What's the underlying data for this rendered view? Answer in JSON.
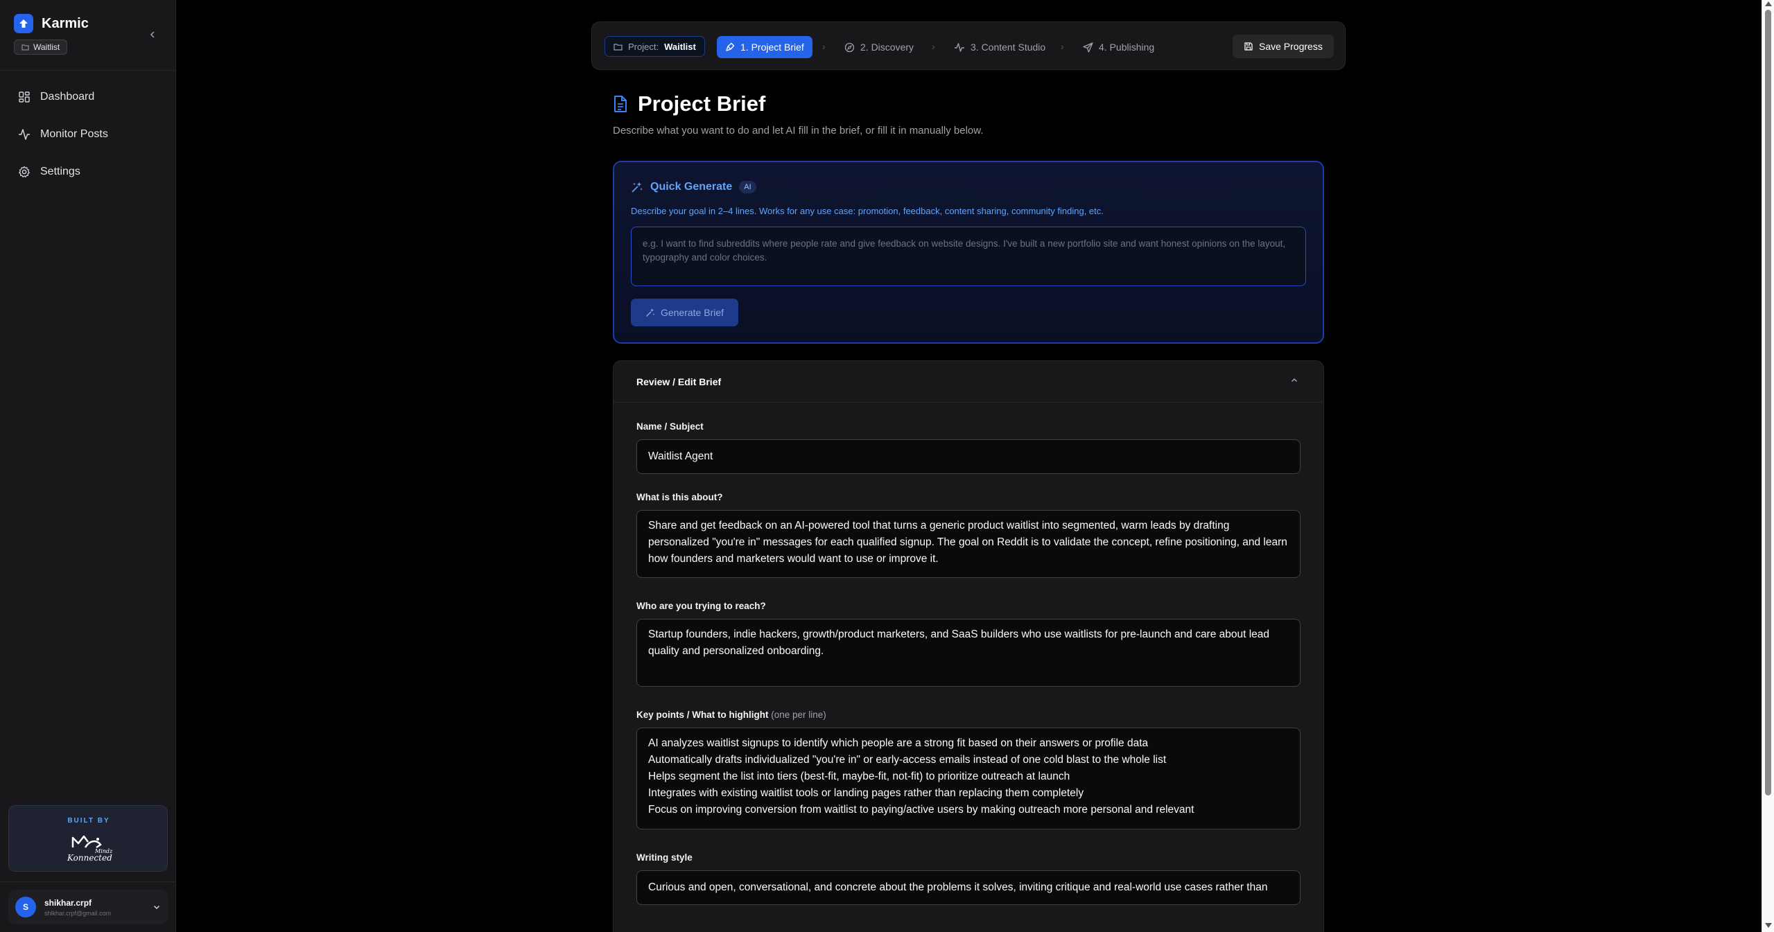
{
  "sidebar": {
    "brand": "Karmic",
    "project_chip": "Waitlist",
    "nav": [
      {
        "label": "Dashboard",
        "icon": "dashboard-icon"
      },
      {
        "label": "Monitor Posts",
        "icon": "activity-icon"
      },
      {
        "label": "Settings",
        "icon": "gear-icon"
      }
    ],
    "built_by_label": "BUILT BY",
    "built_by_logo_text": "Mindz Konnected",
    "user": {
      "initial": "S",
      "name": "shikhar.crpf",
      "email": "shikhar.crpf@gmail.com"
    }
  },
  "stepper": {
    "project_label": "Project:",
    "project_name": "Waitlist",
    "steps": [
      "1. Project Brief",
      "2. Discovery",
      "3. Content Studio",
      "4. Publishing"
    ],
    "active_step": 0,
    "separator": "›",
    "save_label": "Save Progress"
  },
  "header": {
    "title": "Project Brief",
    "subtitle": "Describe what you want to do and let AI fill in the brief, or fill it in manually below."
  },
  "quick_generate": {
    "title": "Quick Generate",
    "badge": "AI",
    "description": "Describe your goal in 2–4 lines. Works for any use case: promotion, feedback, content sharing, community finding, etc.",
    "placeholder": "e.g. I want to find subreddits where people rate and give feedback on website designs. I've built a new portfolio site and want honest opinions on the layout, typography and color choices.",
    "button_label": "Generate Brief"
  },
  "review": {
    "title": "Review / Edit Brief",
    "fields": {
      "name": {
        "label": "Name / Subject",
        "value": "Waitlist Agent"
      },
      "about": {
        "label": "What is this about?",
        "value": "Share and get feedback on an AI-powered tool that turns a generic product waitlist into segmented, warm leads by drafting personalized \"you're in\" messages for each qualified signup. The goal on Reddit is to validate the concept, refine positioning, and learn how founders and marketers would want to use or improve it."
      },
      "audience": {
        "label": "Who are you trying to reach?",
        "value": "Startup founders, indie hackers, growth/product marketers, and SaaS builders who use waitlists for pre-launch and care about lead quality and personalized onboarding."
      },
      "key_points": {
        "label": "Key points / What to highlight",
        "hint": "(one per line)",
        "value": "AI analyzes waitlist signups to identify which people are a strong fit based on their answers or profile data\nAutomatically drafts individualized \"you're in\" or early-access emails instead of one cold blast to the whole list\nHelps segment the list into tiers (best-fit, maybe-fit, not-fit) to prioritize outreach at launch\nIntegrates with existing waitlist tools or landing pages rather than replacing them completely\nFocus on improving conversion from waitlist to paying/active users by making outreach more personal and relevant"
      },
      "style": {
        "label": "Writing style",
        "value": "Curious and open, conversational, and concrete about the problems it solves, inviting critique and real-world use cases rather than"
      }
    }
  },
  "colors": {
    "accent": "#2563eb",
    "accent_text": "#60a5fa",
    "background": "#000000",
    "panel": "#18181b"
  }
}
